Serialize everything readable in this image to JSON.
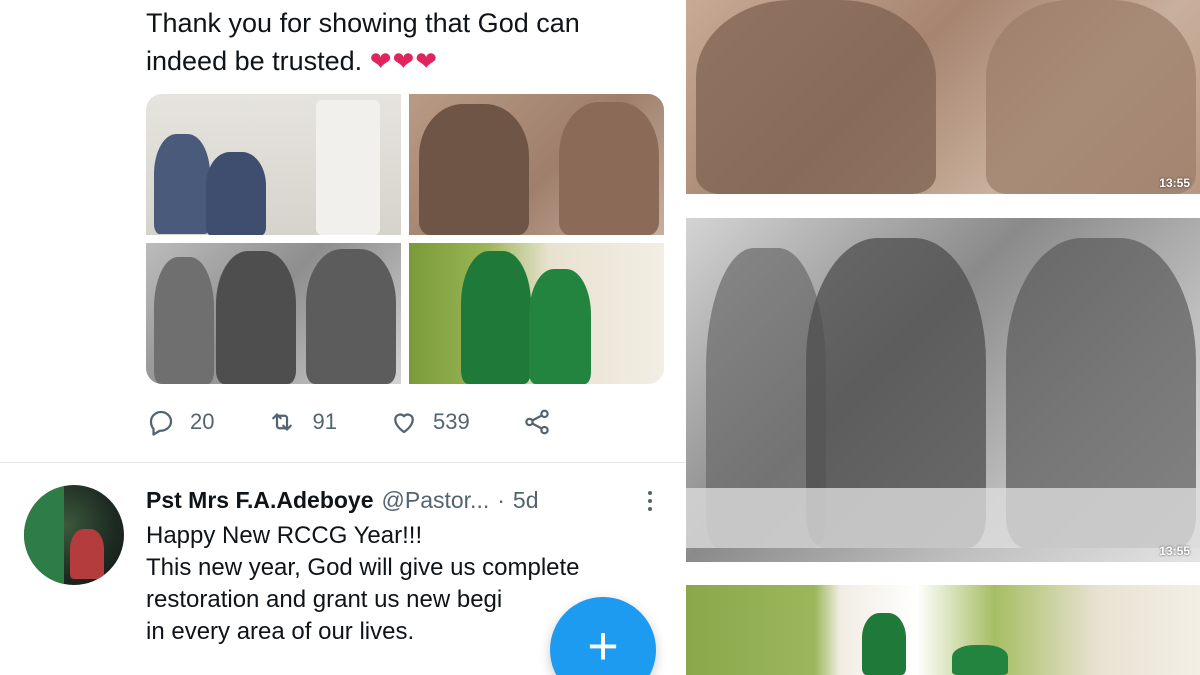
{
  "tweet1": {
    "text": "Thank you for showing that God can indeed be trusted.",
    "emoji": "❤❤❤",
    "stats": {
      "replies": "20",
      "retweets": "91",
      "likes": "539"
    }
  },
  "tweet2": {
    "name": "Pst Mrs F.A.Adeboye",
    "handle": "@Pastor...",
    "separator": "·",
    "time": "5d",
    "line1": "Happy New RCCG Year!!!",
    "line2": "This new year, God will give us complete restoration and grant us new begi",
    "line3": "in every area of our lives."
  },
  "compose_button": {
    "icon": "plus-icon"
  },
  "viewer": {
    "timestamps": [
      "13:55",
      "13:55"
    ]
  },
  "colors": {
    "accent": "#1d9bf0",
    "heart": "#e0245e",
    "muted": "#536471"
  }
}
